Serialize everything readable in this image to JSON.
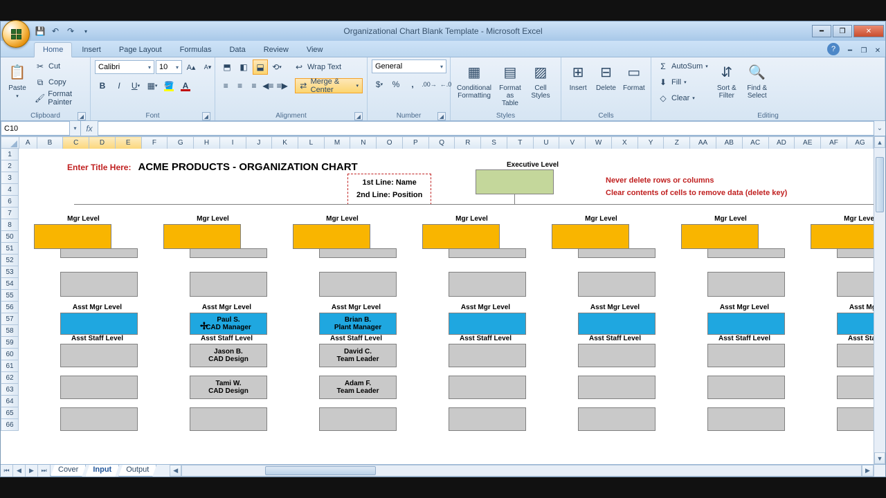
{
  "window": {
    "title": "Organizational Chart Blank Template - Microsoft Excel"
  },
  "tabs": {
    "home": "Home",
    "insert": "Insert",
    "pageLayout": "Page Layout",
    "formulas": "Formulas",
    "data": "Data",
    "review": "Review",
    "view": "View"
  },
  "clipboard": {
    "paste": "Paste",
    "cut": "Cut",
    "copy": "Copy",
    "formatPainter": "Format Painter",
    "label": "Clipboard"
  },
  "font": {
    "name": "Calibri",
    "size": "10",
    "label": "Font"
  },
  "alignment": {
    "wrap": "Wrap Text",
    "merge": "Merge & Center",
    "label": "Alignment"
  },
  "number": {
    "format": "General",
    "label": "Number"
  },
  "styles": {
    "cond": "Conditional Formatting",
    "fmt": "Format as Table",
    "cell": "Cell Styles",
    "label": "Styles"
  },
  "cells": {
    "insert": "Insert",
    "delete": "Delete",
    "format": "Format",
    "label": "Cells"
  },
  "editing": {
    "sum": "AutoSum",
    "fill": "Fill",
    "clear": "Clear",
    "sort": "Sort & Filter",
    "find": "Find & Select",
    "label": "Editing"
  },
  "namebox": "C10",
  "cols": [
    "A",
    "B",
    "C",
    "D",
    "E",
    "F",
    "G",
    "H",
    "I",
    "J",
    "K",
    "L",
    "M",
    "N",
    "O",
    "P",
    "Q",
    "R",
    "S",
    "T",
    "U",
    "V",
    "W",
    "X",
    "Y",
    "Z",
    "AA",
    "AB",
    "AC",
    "AD",
    "AE",
    "AF",
    "AG"
  ],
  "rows_top": [
    "1",
    "2",
    "3",
    "4",
    "6",
    "7",
    "8"
  ],
  "rows_bot": [
    "50",
    "51",
    "52",
    "53",
    "54",
    "55",
    "56",
    "57",
    "58",
    "59",
    "60",
    "61",
    "62",
    "63",
    "64",
    "65",
    "66"
  ],
  "sheet": {
    "titleLabel": "Enter Title Here:",
    "titleValue": "ACME PRODUCTS - ORGANIZATION CHART",
    "legend_l1": "1st Line: Name",
    "legend_l2": "2nd Line: Position",
    "execLabel": "Executive Level",
    "note1": "Never delete rows or columns",
    "note2": "Clear contents of cells to remove data (delete key)",
    "mgrLevel": "Mgr Level",
    "asstMgrLevel": "Asst Mgr Level",
    "asstStaffLevel": "Asst Staff Level",
    "col2": {
      "asst_name": "Paul S.",
      "asst_pos": "CAD Manager",
      "s1_name": "Jason B.",
      "s1_pos": "CAD Design",
      "s2_name": "Tami W.",
      "s2_pos": "CAD Design"
    },
    "col3": {
      "asst_name": "Brian B.",
      "asst_pos": "Plant Manager",
      "s1_name": "David C.",
      "s1_pos": "Team Leader",
      "s2_name": "Adam F.",
      "s2_pos": "Team Leader"
    }
  },
  "sheets": {
    "cover": "Cover",
    "input": "Input",
    "output": "Output"
  }
}
